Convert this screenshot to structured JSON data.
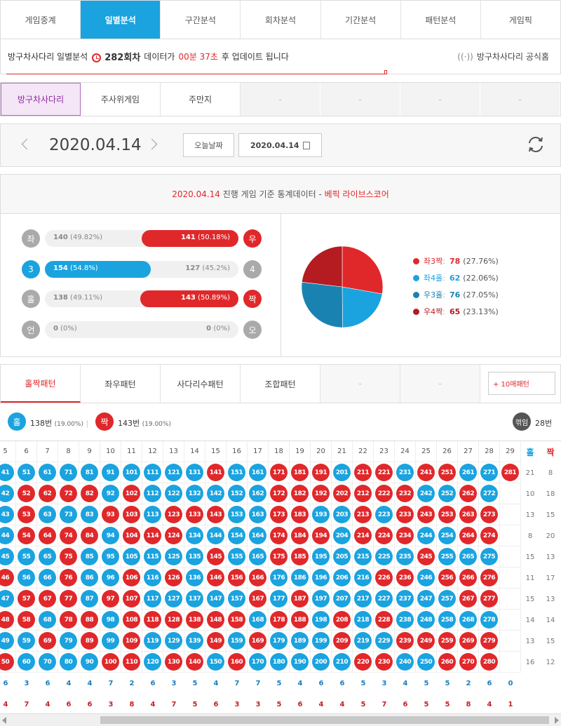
{
  "nav": {
    "tabs": [
      "게임중계",
      "일별분석",
      "구간분석",
      "회차분석",
      "기간분석",
      "패턴분석",
      "게임픽"
    ],
    "active": 1
  },
  "info": {
    "game": "방구차사다리 일별분석",
    "round": "282회차",
    "mid": "데이터가",
    "time": "00분 37초",
    "tail": "후 업데이트 됩니다",
    "official": "방구차사다리 공식홈"
  },
  "games": {
    "tabs": [
      "방구차사다리",
      "주사위게임",
      "주만지",
      "-",
      "-",
      "-",
      "-"
    ],
    "active": 0
  },
  "date": {
    "current": "2020.04.14",
    "today_label": "오늘날짜",
    "input_value": "2020.04.14"
  },
  "stats": {
    "title_date": "2020.04.14",
    "title_mid": "진행 게임 기준 통계데이터 -",
    "title_brand": "베픽 라이브스코어",
    "rows": [
      {
        "left_label": "좌",
        "right_label": "우",
        "left_count": "140",
        "left_pct": "(49.82%)",
        "right_count": "141",
        "right_pct": "(50.18%)",
        "left_frac": 0.4982,
        "right_frac": 0.5018,
        "winner": "right",
        "left_color": "#aaaaaa",
        "right_color": "#e0282b"
      },
      {
        "left_label": "3",
        "right_label": "4",
        "left_count": "154",
        "left_pct": "(54.8%)",
        "right_count": "127",
        "right_pct": "(45.2%)",
        "left_frac": 0.548,
        "right_frac": 0.452,
        "winner": "left",
        "left_color": "#1aa3df",
        "right_color": "#aaaaaa"
      },
      {
        "left_label": "홀",
        "right_label": "짝",
        "left_count": "138",
        "left_pct": "(49.11%)",
        "right_count": "143",
        "right_pct": "(50.89%)",
        "left_frac": 0.4911,
        "right_frac": 0.5089,
        "winner": "right",
        "left_color": "#aaaaaa",
        "right_color": "#e0282b"
      },
      {
        "left_label": "언",
        "right_label": "오",
        "left_count": "0",
        "left_pct": "(0%)",
        "right_count": "0",
        "right_pct": "(0%)",
        "left_frac": 0,
        "right_frac": 0,
        "winner": "none",
        "left_color": "#aaaaaa",
        "right_color": "#aaaaaa"
      }
    ]
  },
  "chart_data": {
    "type": "pie",
    "series": [
      {
        "name": "좌3짝",
        "value": 78,
        "pct": "(27.76%)",
        "color": "#e0282b"
      },
      {
        "name": "좌4홀",
        "value": 62,
        "pct": "(22.06%)",
        "color": "#1aa3df"
      },
      {
        "name": "우3홀",
        "value": 76,
        "pct": "(27.05%)",
        "color": "#1a82b0"
      },
      {
        "name": "우4짝",
        "value": 65,
        "pct": "(23.13%)",
        "color": "#b41c22"
      }
    ]
  },
  "patterns": {
    "tabs": [
      "홀짝패턴",
      "좌우패턴",
      "사다리수패턴",
      "조합패턴",
      "-",
      "-"
    ],
    "more": "+ 10매패턴"
  },
  "summary": {
    "odd_label": "홀",
    "odd_count": "138번",
    "odd_pct": "(19.00%)",
    "even_label": "짝",
    "even_count": "143번",
    "even_pct": "(19.00%)",
    "break_label": "꺾임",
    "break_count": "28번"
  },
  "grid": {
    "columns": [
      "5",
      "6",
      "7",
      "8",
      "9",
      "10",
      "11",
      "12",
      "13",
      "14",
      "15",
      "16",
      "17",
      "18",
      "19",
      "20",
      "21",
      "22",
      "23",
      "24",
      "25",
      "26",
      "27",
      "28",
      "29"
    ],
    "odd_header": "홀",
    "even_header": "짝",
    "rows": [
      {
        "cells": [
          "o41",
          "o51",
          "o61",
          "o71",
          "o81",
          "o91",
          "o101",
          "o111",
          "o121",
          "o131",
          "e141",
          "o151",
          "o161",
          "e171",
          "e181",
          "e191",
          "o201",
          "e211",
          "e221",
          "o231",
          "e241",
          "e251",
          "o261",
          "o271",
          "e281"
        ],
        "odd": "21",
        "even": "8"
      },
      {
        "cells": [
          "o42",
          "e52",
          "e62",
          "e72",
          "e82",
          "o92",
          "e102",
          "o112",
          "o122",
          "o132",
          "o142",
          "o152",
          "o162",
          "e172",
          "e182",
          "e192",
          "e202",
          "e212",
          "e222",
          "e232",
          "o242",
          "o252",
          "e262",
          "o272",
          ""
        ],
        "odd": "10",
        "even": "18"
      },
      {
        "cells": [
          "o43",
          "e53",
          "o63",
          "o73",
          "o83",
          "e93",
          "e103",
          "o113",
          "e123",
          "e133",
          "e143",
          "o153",
          "o163",
          "e173",
          "e183",
          "o193",
          "o203",
          "e213",
          "o223",
          "e233",
          "e243",
          "e253",
          "e263",
          "e273",
          ""
        ],
        "odd": "13",
        "even": "15"
      },
      {
        "cells": [
          "o44",
          "e54",
          "e64",
          "e74",
          "e84",
          "o94",
          "e104",
          "e114",
          "e124",
          "o134",
          "o144",
          "o154",
          "o164",
          "e174",
          "e184",
          "e194",
          "o204",
          "e214",
          "e224",
          "e234",
          "o244",
          "o254",
          "e264",
          "e274",
          ""
        ],
        "odd": "8",
        "even": "20"
      },
      {
        "cells": [
          "o45",
          "o55",
          "o65",
          "e75",
          "o85",
          "o95",
          "o105",
          "o115",
          "o125",
          "o135",
          "e145",
          "o155",
          "o165",
          "e175",
          "e185",
          "o195",
          "o205",
          "o215",
          "o225",
          "o235",
          "e245",
          "o255",
          "o265",
          "o275",
          ""
        ],
        "odd": "15",
        "even": "13"
      },
      {
        "cells": [
          "e46",
          "o56",
          "o66",
          "e76",
          "o86",
          "o96",
          "e106",
          "o116",
          "e126",
          "o136",
          "e146",
          "e156",
          "e166",
          "o176",
          "o186",
          "o196",
          "o206",
          "o216",
          "e226",
          "e236",
          "o246",
          "e256",
          "e266",
          "e276",
          ""
        ],
        "odd": "11",
        "even": "17"
      },
      {
        "cells": [
          "o47",
          "e57",
          "e67",
          "e77",
          "o87",
          "e97",
          "e107",
          "o117",
          "o127",
          "o137",
          "o147",
          "o157",
          "e167",
          "o177",
          "e187",
          "o197",
          "o207",
          "o217",
          "o227",
          "o237",
          "o247",
          "o257",
          "e267",
          "e277",
          ""
        ],
        "odd": "15",
        "even": "13"
      },
      {
        "cells": [
          "e48",
          "e58",
          "o68",
          "e78",
          "e88",
          "o98",
          "e108",
          "e118",
          "e128",
          "e138",
          "e148",
          "e158",
          "o168",
          "e178",
          "e188",
          "o198",
          "e208",
          "o218",
          "e228",
          "o238",
          "o248",
          "o258",
          "o268",
          "o278",
          ""
        ],
        "odd": "14",
        "even": "14"
      },
      {
        "cells": [
          "o49",
          "o59",
          "e69",
          "o79",
          "e89",
          "o99",
          "e109",
          "o119",
          "o129",
          "o139",
          "e149",
          "o159",
          "e169",
          "o179",
          "o189",
          "o199",
          "e209",
          "o219",
          "o229",
          "e239",
          "e249",
          "e259",
          "e269",
          "e279",
          ""
        ],
        "odd": "13",
        "even": "15"
      },
      {
        "cells": [
          "e50",
          "o60",
          "o70",
          "o80",
          "o90",
          "e100",
          "e110",
          "o120",
          "e130",
          "e140",
          "o150",
          "e160",
          "o170",
          "o180",
          "o190",
          "o200",
          "o210",
          "e220",
          "e230",
          "o240",
          "o250",
          "e260",
          "e270",
          "e280",
          ""
        ],
        "odd": "16",
        "even": "12"
      }
    ],
    "odd_totals": [
      "6",
      "3",
      "6",
      "4",
      "4",
      "7",
      "2",
      "6",
      "3",
      "5",
      "4",
      "7",
      "7",
      "5",
      "4",
      "6",
      "6",
      "5",
      "3",
      "4",
      "5",
      "5",
      "2",
      "6",
      "0"
    ],
    "even_totals": [
      "4",
      "7",
      "4",
      "6",
      "6",
      "3",
      "8",
      "4",
      "7",
      "5",
      "6",
      "3",
      "3",
      "5",
      "6",
      "4",
      "4",
      "5",
      "7",
      "6",
      "5",
      "5",
      "8",
      "4",
      "1"
    ]
  }
}
